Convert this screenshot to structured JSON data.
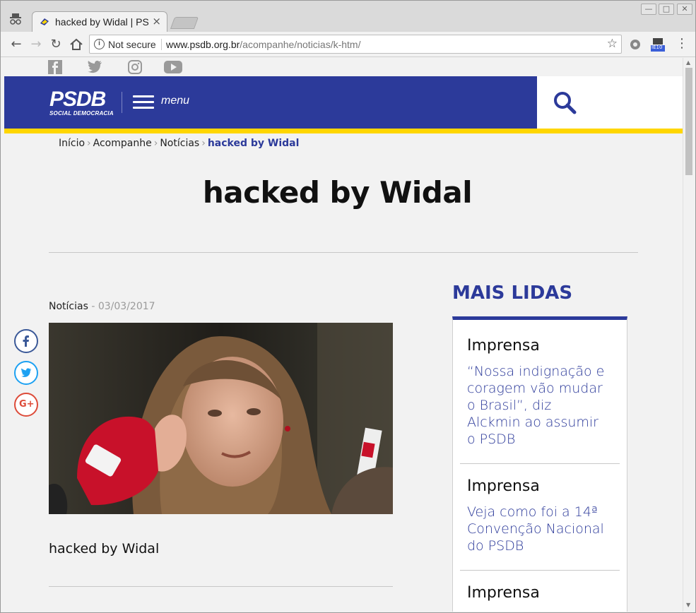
{
  "browser": {
    "tab_title": "hacked by Widal | PSDB",
    "tab_close": "×",
    "security_label": "Not secure",
    "url_host": "www.psdb.org.br",
    "url_path": "/acompanhe/noticias/k-htm/",
    "extension_badge": "IE10"
  },
  "site": {
    "social": [
      "facebook",
      "twitter",
      "instagram",
      "youtube"
    ],
    "logo_main": "PSDB",
    "logo_sub": "SOCIAL DEMOCRACIA",
    "menu_label": "menu",
    "accent_color": "#2c3a9a",
    "stripe_color": "#ffd600"
  },
  "breadcrumb": {
    "items": [
      "Início",
      "Acompanhe",
      "Notícias"
    ],
    "current": "hacked by Widal"
  },
  "article": {
    "title": "hacked by Widal",
    "category": "Notícias",
    "date": " - 03/03/2017",
    "lead": "hacked by Widal"
  },
  "share": [
    "facebook",
    "twitter",
    "google-plus"
  ],
  "sidebar": {
    "title": "MAIS LIDAS",
    "items": [
      {
        "category": "Imprensa",
        "link": "“Nossa indignação e coragem vão mudar o Brasil”, diz Alckmin ao assumir o PSDB"
      },
      {
        "category": "Imprensa",
        "link": "Veja como foi a 14ª Convenção Nacional do PSDB"
      },
      {
        "category": "Imprensa",
        "link": ""
      }
    ]
  }
}
